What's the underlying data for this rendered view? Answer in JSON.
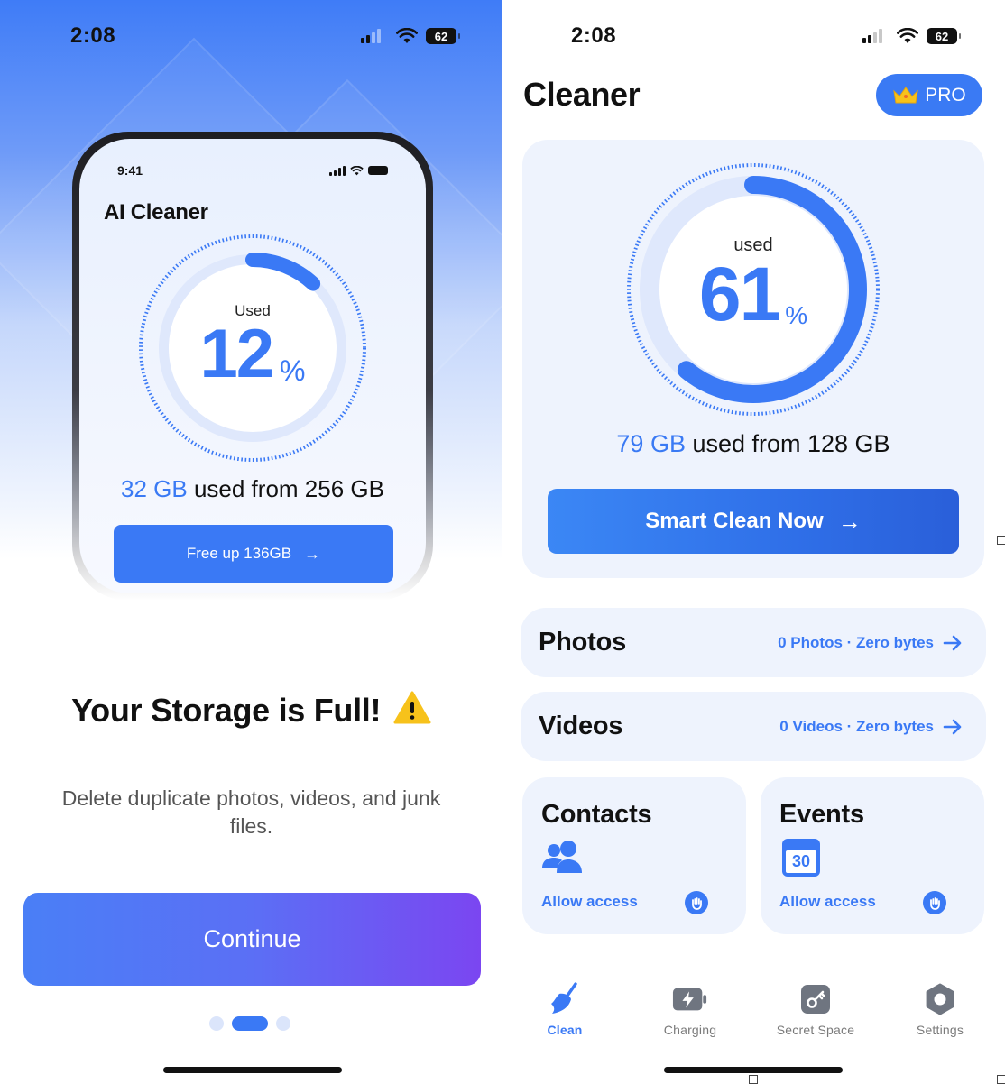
{
  "onboarding": {
    "status_bar": {
      "time": "2:08",
      "battery": "62"
    },
    "mockup": {
      "time": "9:41",
      "app_title": "AI Cleaner",
      "ring_label": "Used",
      "percent": "12",
      "percent_sign": "%",
      "used_fraction": 0.12,
      "used_amount": "32 GB",
      "used_suffix": " used from 256 GB",
      "button_label": "Free up 136GB",
      "button_arrow": "→"
    },
    "headline": "Your Storage is Full!",
    "headline_icon": "warning-icon",
    "description": "Delete duplicate photos, videos, and junk files.",
    "continue_label": "Continue",
    "page_indicator": {
      "count": 3,
      "active_index": 1
    },
    "colors": {
      "accent": "#3a79f5",
      "gradient_end": "#7b46f1"
    }
  },
  "home": {
    "status_bar": {
      "time": "2:08",
      "battery": "62"
    },
    "title": "Cleaner",
    "pro_label": "PRO",
    "pro_icon": "crown-icon",
    "storage": {
      "ring_label": "used",
      "percent": "61",
      "percent_sign": "%",
      "used_fraction": 0.61,
      "used_amount": "79 GB",
      "used_suffix": " used from 128 GB"
    },
    "smart_clean_label": "Smart Clean Now",
    "smart_clean_arrow": "→",
    "photos": {
      "title": "Photos",
      "meta": "0 Photos · Zero bytes"
    },
    "videos": {
      "title": "Videos",
      "meta": "0 Videos · Zero bytes"
    },
    "contacts": {
      "title": "Contacts",
      "action": "Allow access",
      "icon": "contacts-icon"
    },
    "events": {
      "title": "Events",
      "action": "Allow access",
      "icon": "calendar-icon",
      "calendar_day": "30"
    },
    "tabs": [
      {
        "label": "Clean",
        "icon": "broom-icon",
        "active": true
      },
      {
        "label": "Charging",
        "icon": "battery-bolt-icon",
        "active": false
      },
      {
        "label": "Secret Space",
        "icon": "key-icon",
        "active": false
      },
      {
        "label": "Settings",
        "icon": "gear-icon",
        "active": false
      }
    ],
    "colors": {
      "accent": "#3a79f5",
      "card_bg": "#eef3fd"
    }
  }
}
